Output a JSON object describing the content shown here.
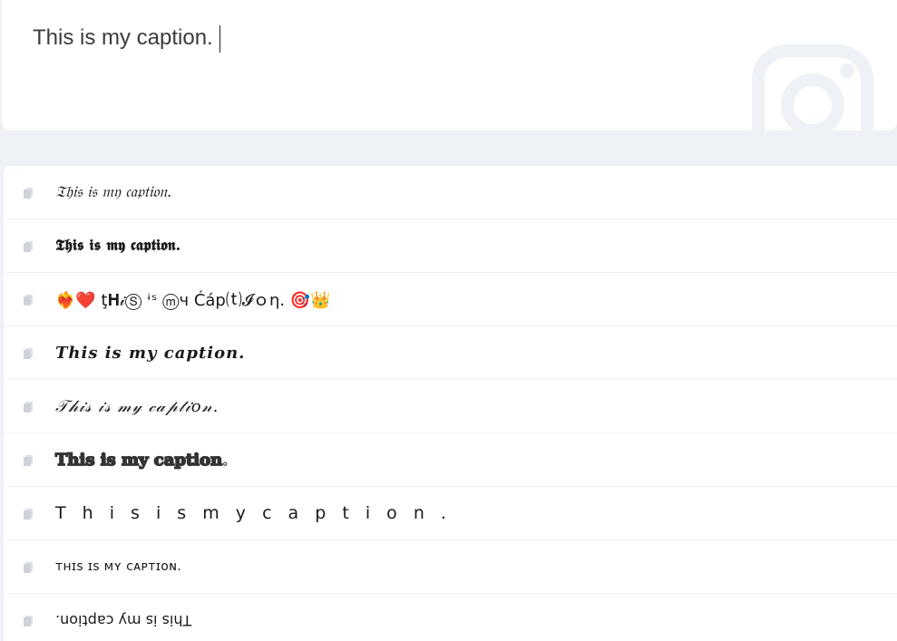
{
  "caption_input": {
    "value": "This is my caption."
  },
  "icons": {
    "watermark": "instagram-icon",
    "copy": "copy-icon"
  },
  "colors": {
    "page_background": "#eef1f6",
    "card_background": "#ffffff",
    "watermark": "#eef1f6",
    "copy_icon": "#d6d9df"
  },
  "results": [
    {
      "text": "𝔗𝔥𝔦𝔰 𝔦𝔰 𝔪𝔶 𝔠𝔞𝔭𝔱𝔦𝔬𝔫."
    },
    {
      "text": "𝕿𝖍𝖎𝖘 𝖎𝖘 𝖒𝖞 𝖈𝖆𝖕𝖙𝖎𝖔𝖓."
    },
    {
      "text": "❤️‍🔥❤️ ţ𝐇𝒾Ⓢ ᶤˢ ⓜч Ćáp⒯𝓘ｏη. 🎯👑"
    },
    {
      "text": "𝑻𝒉𝒊𝒔 𝒊𝒔 𝒎𝒚 𝒄𝒂𝒑𝒕𝒊𝒐𝒏."
    },
    {
      "text": "𝒯𝒽𝒾𝓈 𝒾𝓈 𝓂𝓎 𝒸𝒶𝓅𝓉𝒾𝑜𝓃."
    },
    {
      "text": "𝕋𝕙𝕚𝕤 𝕚𝕤 𝕞𝕪 𝕔𝕒𝕡𝕥𝕚𝕠𝕟."
    },
    {
      "text": "T h i s  i s m y  c a p t i o n ."
    },
    {
      "text": "ᴛʜɪs ɪs ᴍʏ ᴄᴀᴘᴛɪᴏɴ."
    },
    {
      "text": "This is my caption."
    }
  ]
}
